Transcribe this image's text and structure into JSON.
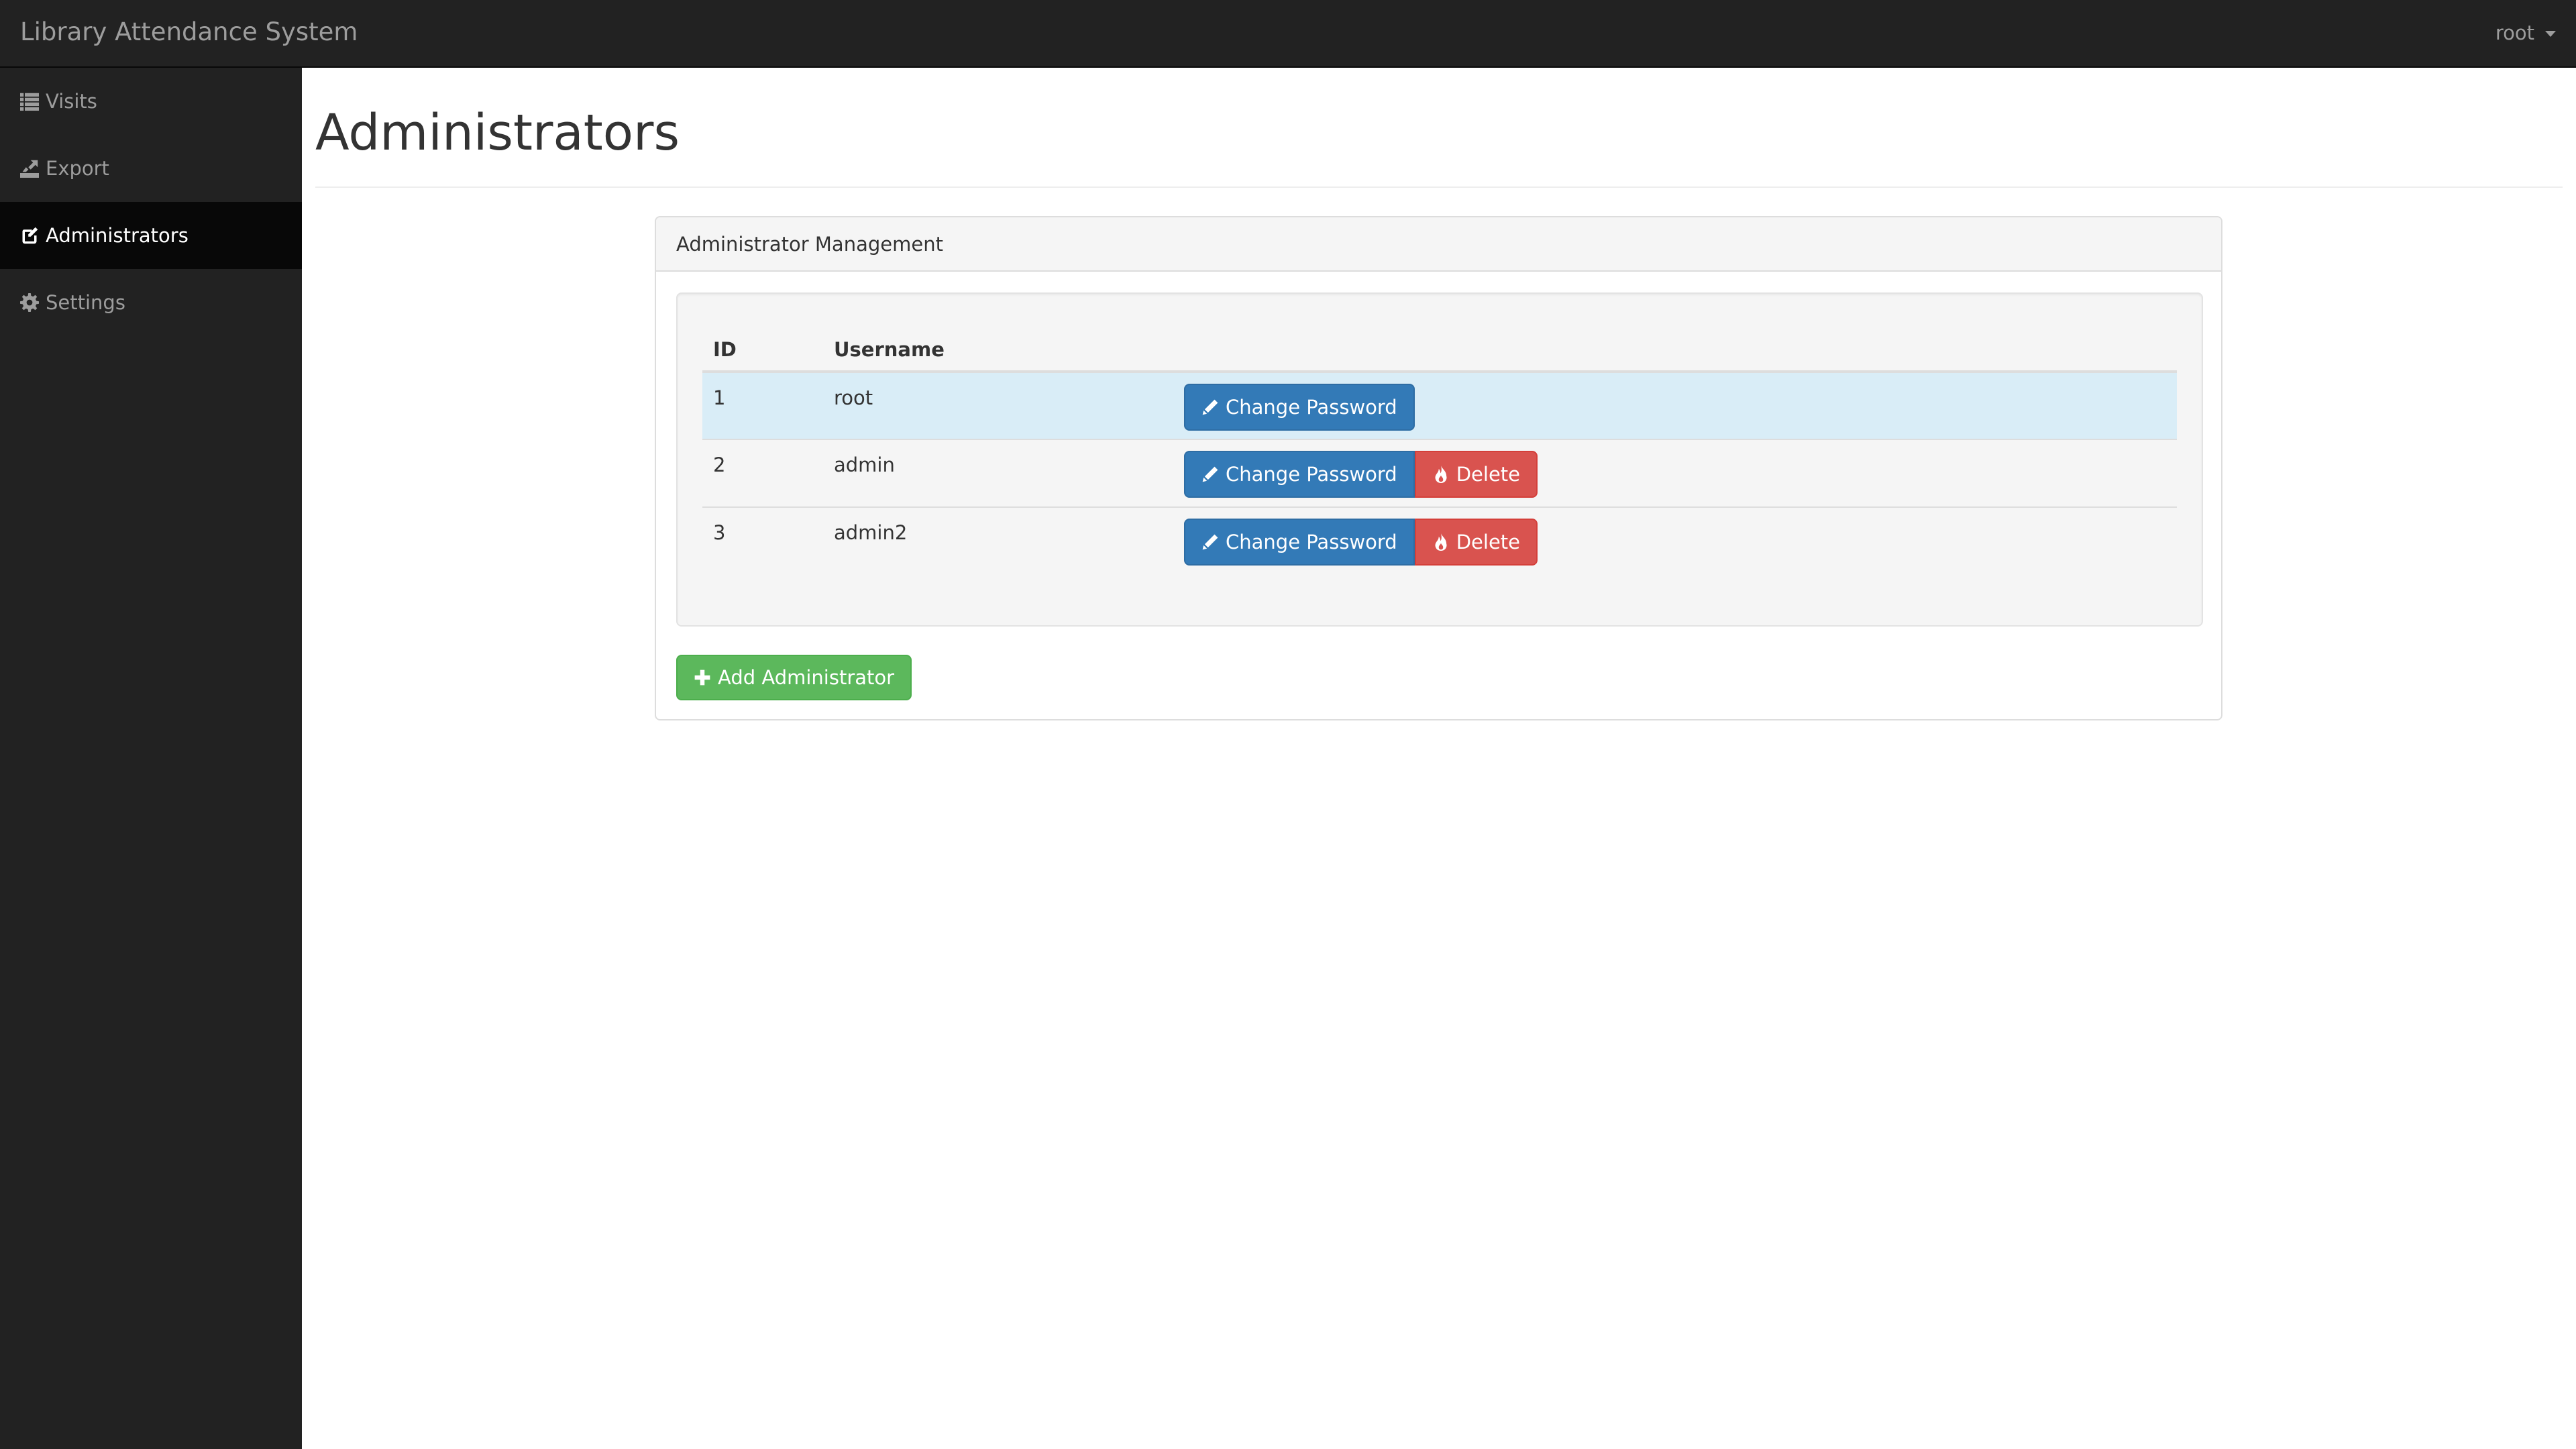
{
  "navbar": {
    "brand": "Library Attendance System",
    "user": "root"
  },
  "sidebar": {
    "items": [
      {
        "label": "Visits",
        "icon": "list-icon",
        "active": false
      },
      {
        "label": "Export",
        "icon": "export-icon",
        "active": false
      },
      {
        "label": "Administrators",
        "icon": "edit-icon",
        "active": true
      },
      {
        "label": "Settings",
        "icon": "cog-icon",
        "active": false
      }
    ]
  },
  "page": {
    "title": "Administrators"
  },
  "panel": {
    "heading": "Administrator Management",
    "table": {
      "headers": {
        "id": "ID",
        "username": "Username",
        "actions": ""
      },
      "rows": [
        {
          "id": "1",
          "username": "root",
          "change_password": "Change Password",
          "delete": null,
          "highlighted": true
        },
        {
          "id": "2",
          "username": "admin",
          "change_password": "Change Password",
          "delete": "Delete",
          "highlighted": false
        },
        {
          "id": "3",
          "username": "admin2",
          "change_password": "Change Password",
          "delete": "Delete",
          "highlighted": false
        }
      ]
    },
    "add_button": "Add Administrator"
  },
  "colors": {
    "navbar_bg": "#222222",
    "active_item_bg": "#080808",
    "primary": "#337ab7",
    "danger": "#d9534f",
    "success": "#5cb85c",
    "info_row": "#d9edf7"
  }
}
